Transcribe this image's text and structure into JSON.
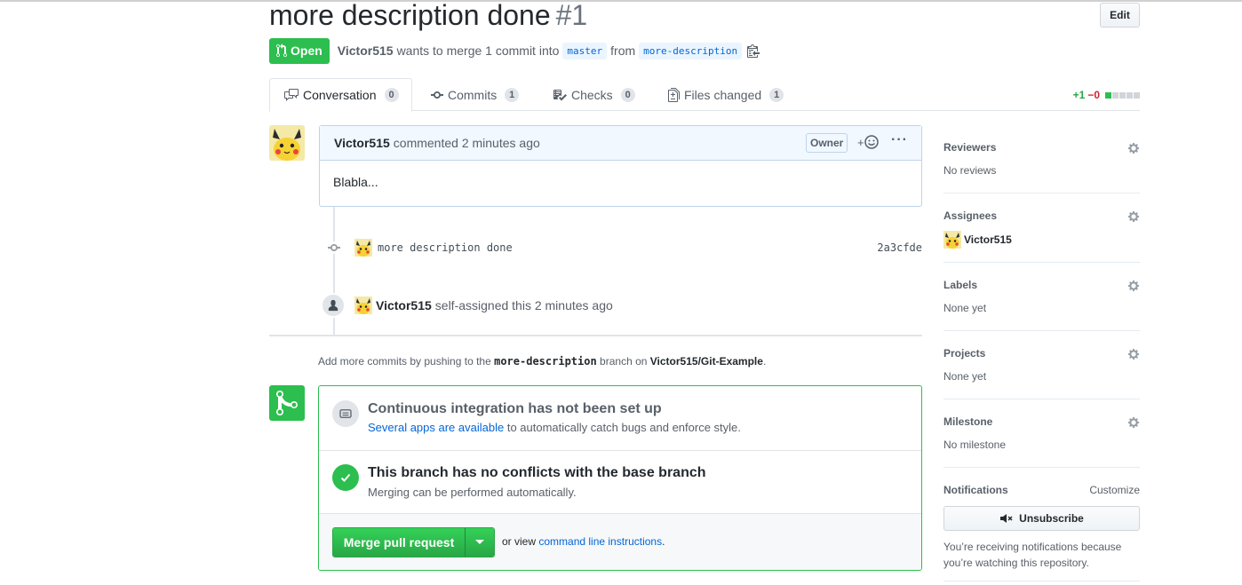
{
  "pr": {
    "title": "more description done",
    "number": "#1",
    "edit_label": "Edit",
    "state": "Open",
    "author": "Victor515",
    "merge_text": "wants to merge 1 commit into",
    "base_branch": "master",
    "from_text": "from",
    "head_branch": "more-description"
  },
  "tabs": [
    {
      "label": "Conversation",
      "count": "0"
    },
    {
      "label": "Commits",
      "count": "1"
    },
    {
      "label": "Checks",
      "count": "0"
    },
    {
      "label": "Files changed",
      "count": "1"
    }
  ],
  "diffstat": {
    "additions": "+1",
    "deletions": "−0"
  },
  "comment": {
    "author": "Victor515",
    "action": "commented 2 minutes ago",
    "role": "Owner",
    "body": "Blabla..."
  },
  "commit": {
    "message": "more description done",
    "sha": "2a3cfde"
  },
  "assign_event": {
    "user": "Victor515",
    "text": "self-assigned this 2 minutes ago"
  },
  "push_hint": {
    "prefix": "Add more commits by pushing to the",
    "branch": "more-description",
    "middle": "branch on",
    "repo": "Victor515/Git-Example",
    "suffix": "."
  },
  "merge": {
    "ci_title": "Continuous integration has not been set up",
    "ci_link": "Several apps are available",
    "ci_text": "to automatically catch bugs and enforce style.",
    "conflict_title": "This branch has no conflicts with the base branch",
    "conflict_sub": "Merging can be performed automatically.",
    "button": "Merge pull request",
    "or_view": "or view",
    "cli_link": "command line instructions",
    "period": "."
  },
  "sidebar": {
    "reviewers": {
      "label": "Reviewers",
      "value": "No reviews"
    },
    "assignees": {
      "label": "Assignees",
      "value": "Victor515"
    },
    "labels": {
      "label": "Labels",
      "value": "None yet"
    },
    "projects": {
      "label": "Projects",
      "value": "None yet"
    },
    "milestone": {
      "label": "Milestone",
      "value": "No milestone"
    },
    "notifications": {
      "label": "Notifications",
      "customize": "Customize",
      "unsubscribe": "Unsubscribe",
      "text": "You’re receiving notifications because you’re watching this repository."
    }
  },
  "colors": {
    "accent_green": "#2cbe4e",
    "link_blue": "#0366d6",
    "deletion_red": "#cb2431"
  }
}
